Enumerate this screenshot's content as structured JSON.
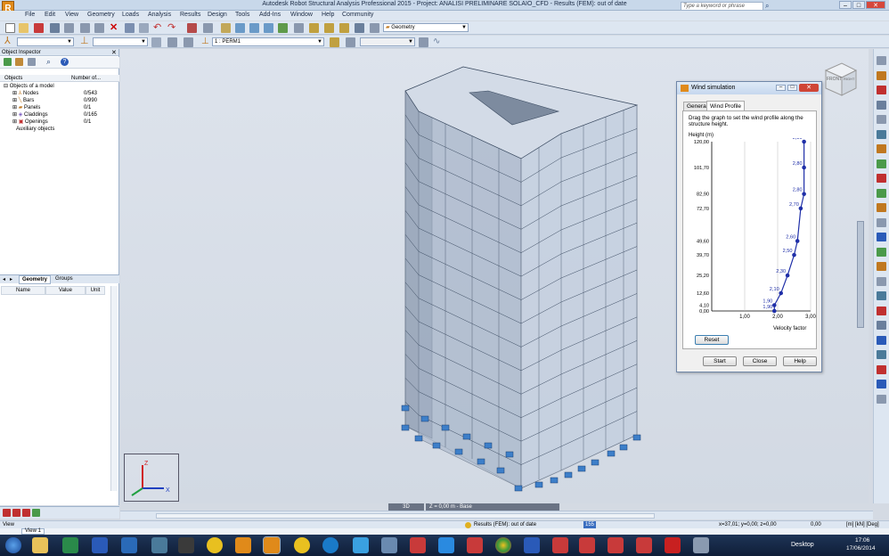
{
  "window": {
    "title": "Autodesk Robot Structural Analysis Professional 2015 - Project: ANALISI PRELIMINARE SOLAIO_CFD - Results (FEM): out of date",
    "app_badge": "R",
    "app_badge_sub": "PRO"
  },
  "menu": [
    "File",
    "Edit",
    "View",
    "Geometry",
    "Loads",
    "Analysis",
    "Results",
    "Design",
    "Tools",
    "Add-Ins",
    "Window",
    "Help",
    "Community"
  ],
  "help_search": {
    "placeholder": "Type a keyword or phrase"
  },
  "toolbar": {
    "geometry_combo": "Geometry",
    "load_case_combo": "1 : PERM1"
  },
  "inspector": {
    "title": "Object Inspector",
    "col_objects": "Objects",
    "col_number": "Number of...",
    "root": "Objects of a model",
    "items": [
      {
        "label": "Nodes",
        "count": "0/543"
      },
      {
        "label": "Bars",
        "count": "0/990"
      },
      {
        "label": "Panels",
        "count": "0/1"
      },
      {
        "label": "Claddings",
        "count": "0/165"
      },
      {
        "label": "Openings",
        "count": "0/1"
      }
    ],
    "auxiliary": "Auxiliary objects",
    "tabs": [
      "Geometry",
      "Groups"
    ],
    "grid_cols": [
      "Name",
      "Value",
      "Unit"
    ]
  },
  "viewcube": {
    "front": "FRONT",
    "right": "RIGHT"
  },
  "view_tabs": {
    "mode": "3D",
    "level": "Z = 0,00 m - Base"
  },
  "wind": {
    "title": "Wind simulation",
    "tabs": [
      "General",
      "Wind Profile"
    ],
    "instruction": "Drag the graph to set the wind profile along the structure height.",
    "height_label": "Height (m)",
    "velocity_label": "Velocity factor",
    "reset": "Reset",
    "start": "Start",
    "close": "Close",
    "help": "Help"
  },
  "chart_data": {
    "type": "line",
    "title": "",
    "xlabel": "Velocity factor",
    "ylabel": "Height (m)",
    "xlim": [
      0,
      3.0
    ],
    "ylim": [
      0,
      120
    ],
    "x_ticks": [
      "1,00",
      "2,00",
      "3,00"
    ],
    "y_ticks": [
      "120,00",
      "101,70",
      "82,90",
      "72,70",
      "49,60",
      "39,70",
      "25,20",
      "12,60",
      "4,10",
      "0,00"
    ],
    "points": [
      {
        "height": 0.0,
        "factor": 1.9,
        "label": "1,90"
      },
      {
        "height": 4.1,
        "factor": 1.9,
        "label": "1,90"
      },
      {
        "height": 12.6,
        "factor": 2.1,
        "label": "2,10"
      },
      {
        "height": 25.2,
        "factor": 2.3,
        "label": "2,30"
      },
      {
        "height": 39.7,
        "factor": 2.5,
        "label": "2,50"
      },
      {
        "height": 49.6,
        "factor": 2.6,
        "label": "2,60"
      },
      {
        "height": 72.7,
        "factor": 2.7,
        "label": "2,70"
      },
      {
        "height": 82.9,
        "factor": 2.8,
        "label": "2,80"
      },
      {
        "height": 101.7,
        "factor": 2.8,
        "label": "2,80"
      },
      {
        "height": 120.0,
        "factor": 2.8,
        "label": "2,80"
      }
    ]
  },
  "status": {
    "view": "View",
    "view_tab": "View 1",
    "results": "Results (FEM): out of date",
    "badge": "155",
    "coords": "x=37,01; y=0,00; z=0,00",
    "value": "0,00",
    "units": "[m] [kN] [Deg]"
  },
  "clock": {
    "desktop": "Desktop",
    "time": "17:06",
    "date": "17/06/2014"
  },
  "colors": {
    "accent": "#1f2fa8",
    "building": "#b6c4d8",
    "support": "#3d7fc9"
  }
}
